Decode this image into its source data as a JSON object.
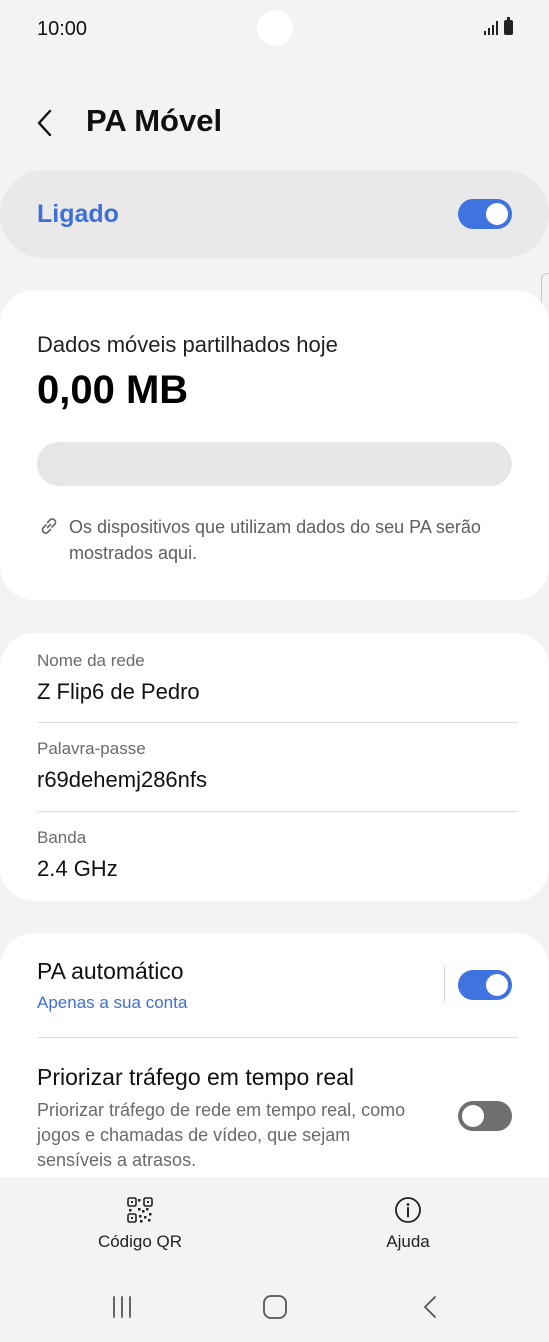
{
  "status_bar": {
    "time": "10:00"
  },
  "header": {
    "title": "PA Móvel"
  },
  "master_switch": {
    "label": "Ligado",
    "on": true
  },
  "usage": {
    "label": "Dados móveis partilhados hoje",
    "value": "0,00 MB",
    "progress": 0,
    "note": "Os dispositivos que utilizam dados do seu PA serão mostrados aqui."
  },
  "network": {
    "name_label": "Nome da rede",
    "name_value": "Z Flip6 de Pedro",
    "password_label": "Palavra-passe",
    "password_value": "r69dehemj286nfs",
    "band_label": "Banda",
    "band_value": "2.4 GHz"
  },
  "options": {
    "auto_title": "PA automático",
    "auto_sub": "Apenas a sua conta",
    "auto_on": true,
    "priority_title": "Priorizar tráfego em tempo real",
    "priority_desc": "Priorizar tráfego de rede em tempo real, como jogos e chamadas de vídeo, que sejam sensíveis a atrasos.",
    "priority_on": false
  },
  "bottom_actions": {
    "qr_label": "Código QR",
    "help_label": "Ajuda"
  },
  "colors": {
    "accent": "#3f73e0",
    "accent_text": "#3e6fd8",
    "toggle_off": "#6f6f6f"
  },
  "icons": [
    "back-icon",
    "link-icon",
    "qr-code-icon",
    "info-icon",
    "recents-icon",
    "home-icon",
    "nav-back-icon"
  ]
}
